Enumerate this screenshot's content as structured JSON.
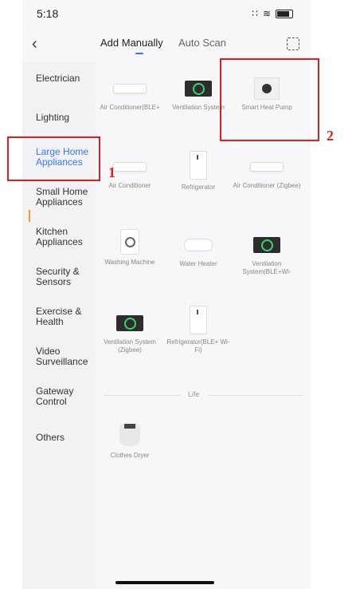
{
  "status_bar": {
    "time": "5:18",
    "signal": "∷",
    "wifi": "≋"
  },
  "nav": {
    "back_icon": "chevron-left-icon",
    "tab_manual": "Add Manually",
    "tab_auto": "Auto Scan",
    "scan_icon": "scan-icon"
  },
  "sidebar": {
    "selected": "Large Home Appliances",
    "items": [
      {
        "label": "Electrician"
      },
      {
        "label": "Lighting"
      },
      {
        "label": "Large Home Appliances"
      },
      {
        "label": "Small Home Appliances"
      },
      {
        "label": "Kitchen Appliances"
      },
      {
        "label": "Security & Sensors"
      },
      {
        "label": "Exercise & Health"
      },
      {
        "label": "Video Surveillance"
      },
      {
        "label": "Gateway Control"
      },
      {
        "label": "Others"
      }
    ]
  },
  "devices": [
    {
      "label": "Air Conditioner(BLE+",
      "icon": "air-conditioner"
    },
    {
      "label": "Ventilation System",
      "icon": "ventilation-system"
    },
    {
      "label": "Smart Heat Pump",
      "icon": "heat-pump"
    },
    {
      "label": "Air Conditioner",
      "icon": "air-conditioner"
    },
    {
      "label": "Refrigerator",
      "icon": "refrigerator"
    },
    {
      "label": "Air Conditioner (Zigbee)",
      "icon": "air-conditioner"
    },
    {
      "label": "Washing Machine",
      "icon": "washing-machine"
    },
    {
      "label": "Water Heater",
      "icon": "water-heater"
    },
    {
      "label": "Ventilation System(BLE+Wi-",
      "icon": "ventilation-system"
    },
    {
      "label": "Ventilation System (Zigbee)",
      "icon": "ventilation-system"
    },
    {
      "label": "Refrigerator(BLE+ Wi-Fi)",
      "icon": "refrigerator"
    }
  ],
  "life_section": {
    "title": "Life",
    "devices": [
      {
        "label": "Clothes Dryer",
        "icon": "clothes-dryer"
      }
    ]
  },
  "annotations": {
    "label_1": "1",
    "label_2": "2",
    "color": "#e02020"
  },
  "colors": {
    "accent": "#3478f6",
    "indicator": "#f0a020",
    "highlight": "#e02020"
  }
}
